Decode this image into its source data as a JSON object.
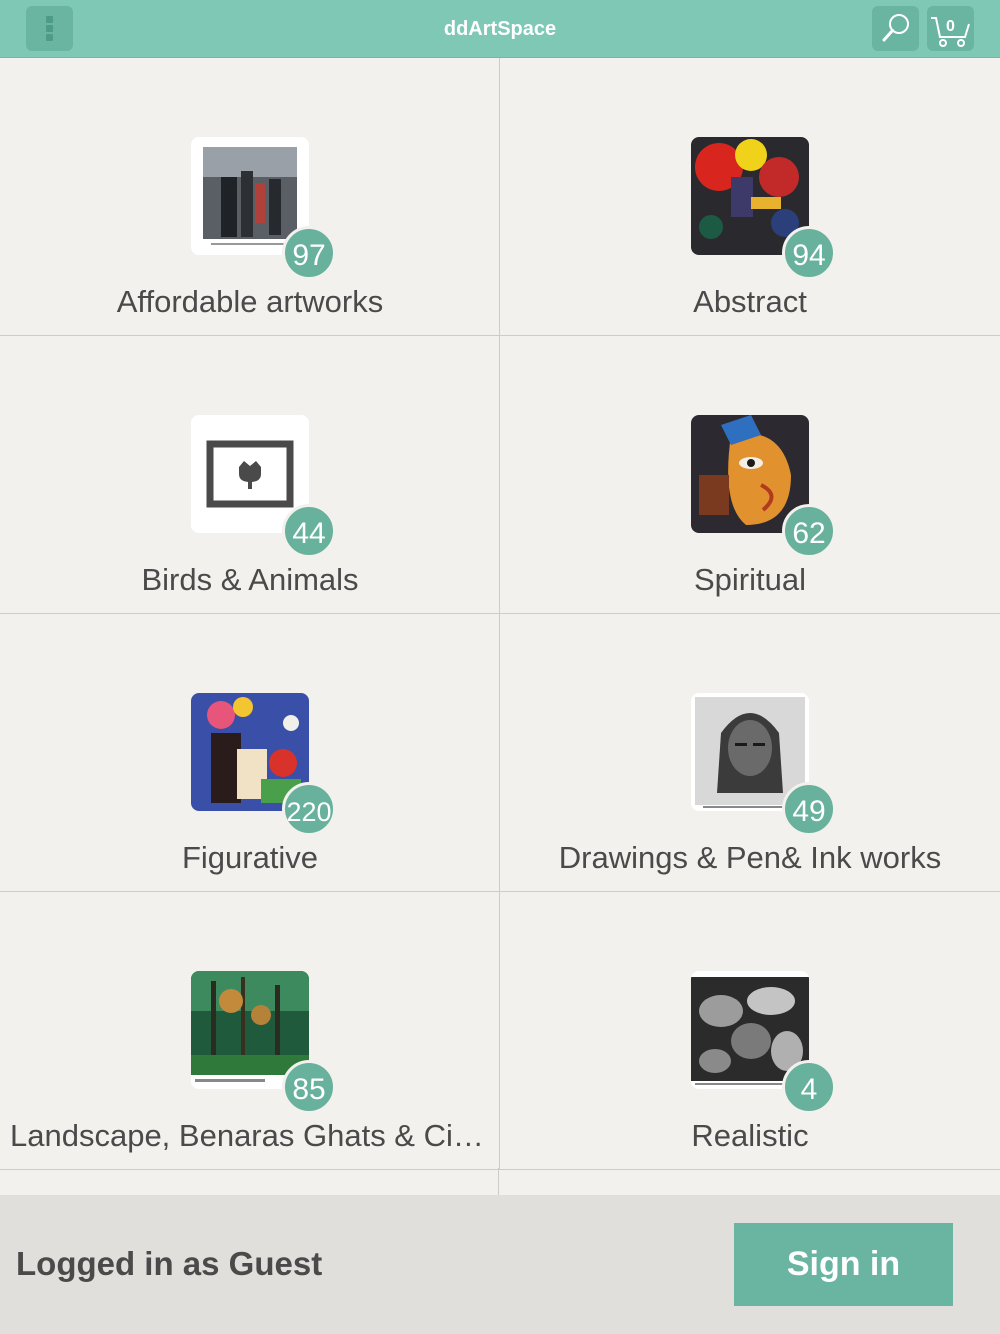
{
  "header": {
    "title": "ddArtSpace",
    "cart_count": "0"
  },
  "categories": [
    {
      "label": "Affordable artworks",
      "count": "97"
    },
    {
      "label": "Abstract",
      "count": "94"
    },
    {
      "label": "Birds & Animals",
      "count": "44"
    },
    {
      "label": "Spiritual",
      "count": "62"
    },
    {
      "label": "Figurative",
      "count": "220"
    },
    {
      "label": "Drawings & Pen& Ink works",
      "count": "49"
    },
    {
      "label": "Landscape, Benaras Ghats  & Cit…",
      "count": "85"
    },
    {
      "label": "Realistic",
      "count": "4"
    }
  ],
  "footer": {
    "status": "Logged in as Guest",
    "signin_label": "Sign in"
  }
}
